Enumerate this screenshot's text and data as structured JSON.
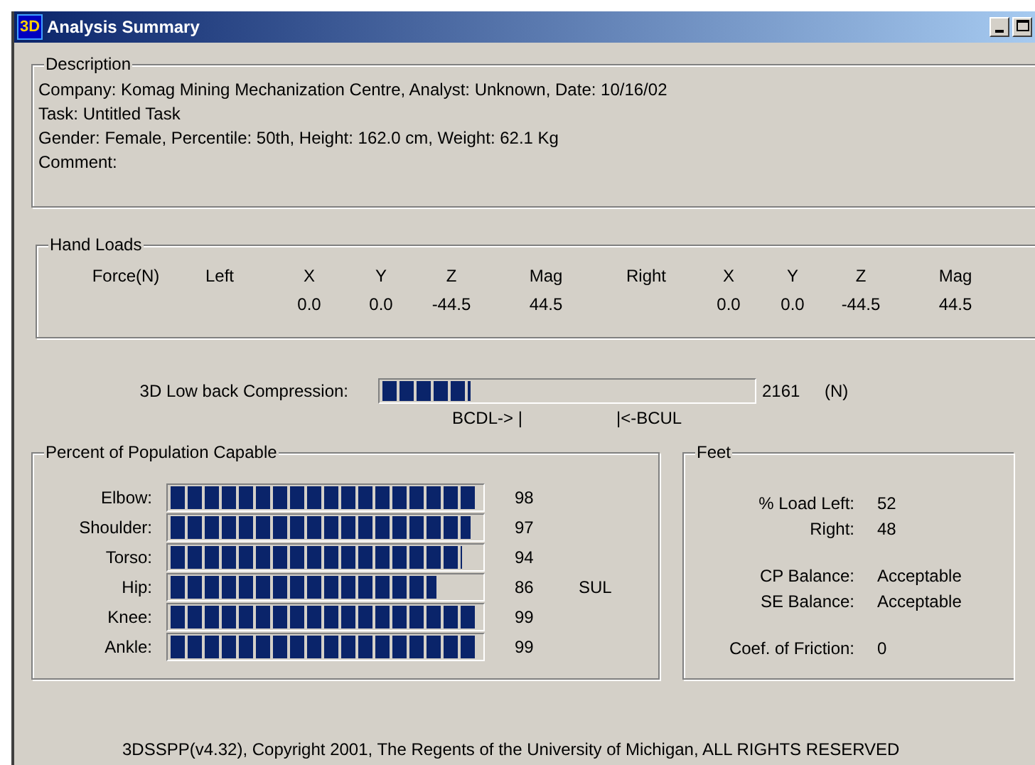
{
  "window": {
    "title": "Analysis Summary",
    "icon_text": "3D"
  },
  "description": {
    "title": "Description",
    "lines": [
      "Company: Komag Mining Mechanization Centre, Analyst: Unknown, Date: 10/16/02",
      "Task: Untitled Task",
      "Gender: Female, Percentile: 50th, Height: 162.0 cm, Weight: 62.1 Kg",
      "Comment:"
    ]
  },
  "hand_loads": {
    "title": "Hand Loads",
    "header": [
      "Force(N)",
      "Left",
      "X",
      "Y",
      "Z",
      "Mag",
      "Right",
      "X",
      "Y",
      "Z",
      "Mag"
    ],
    "values": [
      "0.0",
      "0.0",
      "-44.5",
      "44.5",
      "0.0",
      "0.0",
      "-44.5",
      "44.5"
    ]
  },
  "compression": {
    "label": "3D Low back Compression:",
    "level": 0.24,
    "value": "2161",
    "unit": "(N)",
    "marker_low": "BCDL-> |",
    "marker_high": "|<-BCUL"
  },
  "population": {
    "title": "Percent of Population Capable",
    "rows": [
      {
        "label": "Elbow:",
        "level": 0.98,
        "value": "98"
      },
      {
        "label": "Shoulder:",
        "level": 0.97,
        "value": "97"
      },
      {
        "label": "Torso:",
        "level": 0.94,
        "value": "94"
      },
      {
        "label": "Hip:",
        "level": 0.86,
        "value": "86",
        "flag": "SUL"
      },
      {
        "label": "Knee:",
        "level": 0.99,
        "value": "99"
      },
      {
        "label": "Ankle:",
        "level": 0.99,
        "value": "99"
      }
    ]
  },
  "feet": {
    "title": "Feet",
    "groups": [
      [
        {
          "label": "% Load Left:",
          "value": "52"
        },
        {
          "label": "Right:",
          "value": "48"
        }
      ],
      [
        {
          "label": "CP Balance:",
          "value": "Acceptable"
        },
        {
          "label": "SE Balance:",
          "value": "Acceptable"
        }
      ],
      [
        {
          "label": "Coef. of Friction:",
          "value": "0"
        }
      ]
    ]
  },
  "footer": "3DSSPP(v4.32),  Copyright 2001, The Regents of the University of Michigan, ALL RIGHTS RESERVED"
}
